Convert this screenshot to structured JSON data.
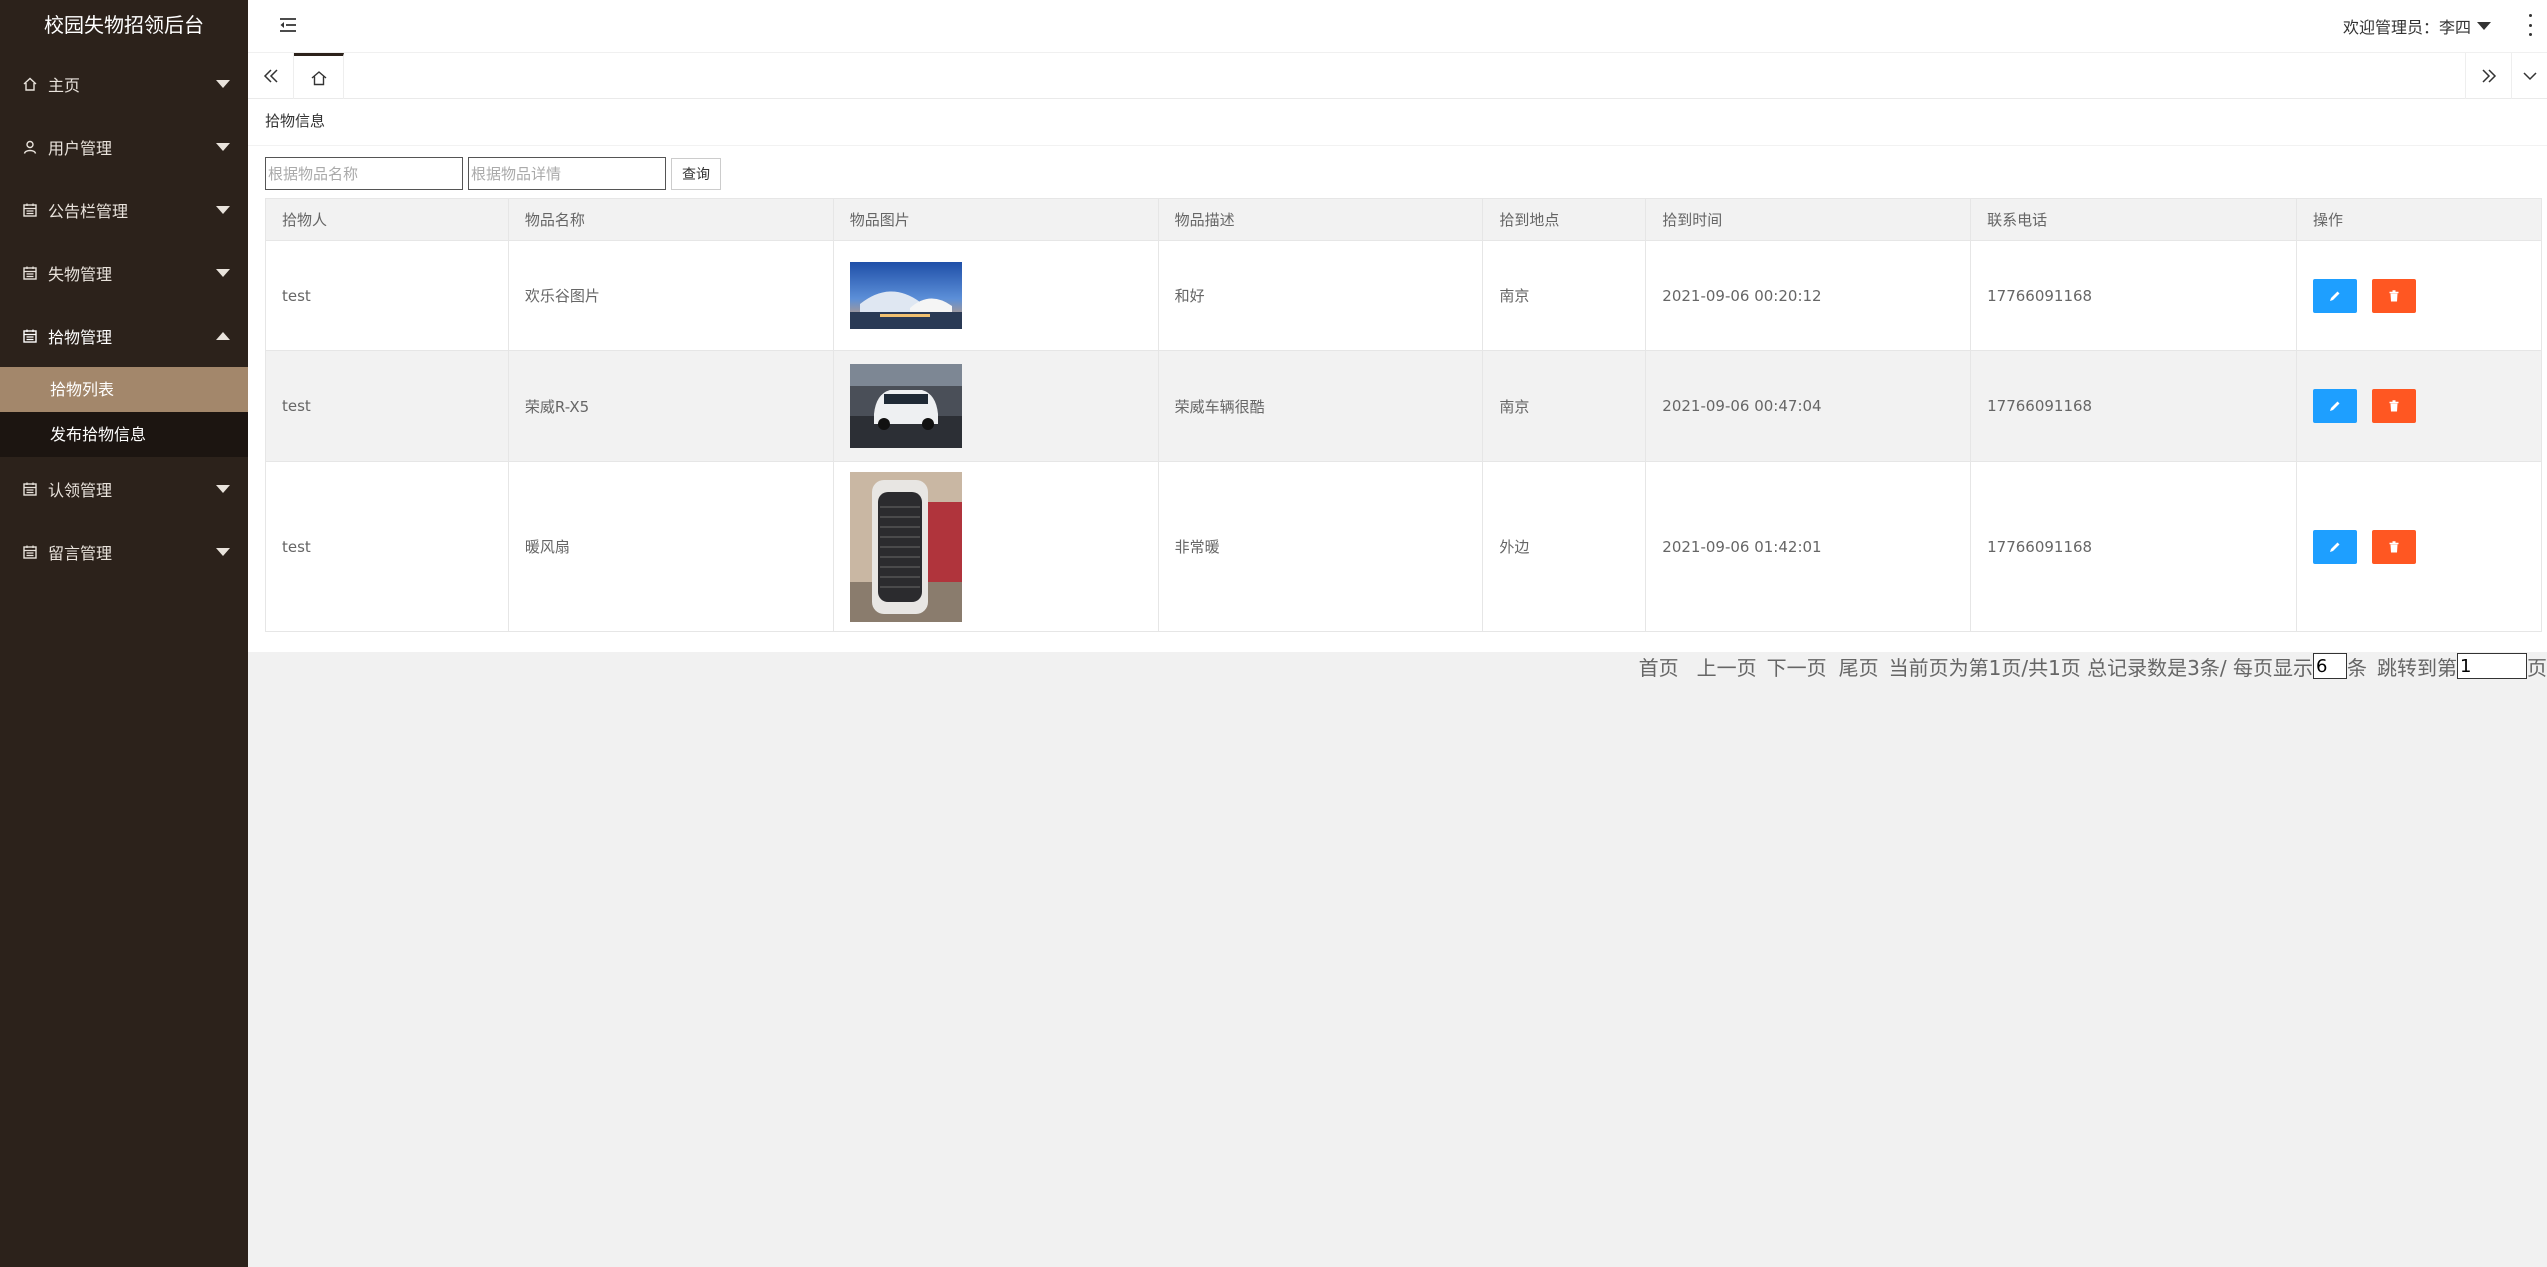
{
  "app_title": "校园失物招领后台",
  "sidebar": {
    "items": [
      {
        "label": "主页"
      },
      {
        "label": "用户管理"
      },
      {
        "label": "公告栏管理"
      },
      {
        "label": "失物管理"
      },
      {
        "label": "拾物管理"
      },
      {
        "label": "认领管理"
      },
      {
        "label": "留言管理"
      }
    ],
    "submenu": [
      {
        "label": "拾物列表"
      },
      {
        "label": "发布拾物信息"
      }
    ]
  },
  "header": {
    "welcome": "欢迎管理员：李四"
  },
  "panel": {
    "title": "拾物信息",
    "search": {
      "name_placeholder": "根据物品名称",
      "detail_placeholder": "根据物品详情",
      "query_label": "查询"
    }
  },
  "table": {
    "headers": [
      "拾物人",
      "物品名称",
      "物品图片",
      "物品描述",
      "拾到地点",
      "拾到时间",
      "联系电话",
      "操作"
    ],
    "rows": [
      {
        "finder": "test",
        "name": "欢乐谷图片",
        "desc": "和好",
        "place": "南京",
        "time": "2021-09-06 00:20:12",
        "phone": "17766091168"
      },
      {
        "finder": "test",
        "name": "荣威R-X5",
        "desc": "荣威车辆很酷",
        "place": "南京",
        "time": "2021-09-06 00:47:04",
        "phone": "17766091168"
      },
      {
        "finder": "test",
        "name": "暖风扇",
        "desc": "非常暖",
        "place": "外边",
        "time": "2021-09-06 01:42:01",
        "phone": "17766091168"
      }
    ]
  },
  "pager": {
    "first": "首页",
    "prev": "上一页",
    "next": "下一页",
    "last": "尾页",
    "info": "当前页为第1页/共1页 总记录数是3条/ 每页显示",
    "page_size": "6",
    "unit": "条",
    "jump_label": "跳转到第",
    "jump_value": "1",
    "page_unit": "页"
  },
  "colors": {
    "sidebar_bg": "#2c221b",
    "submenu_active": "#a3876b",
    "edit_button": "#1e9fff",
    "delete_button": "#ff5722"
  },
  "icons": {
    "edit": "pencil-icon",
    "delete": "trash-icon"
  }
}
